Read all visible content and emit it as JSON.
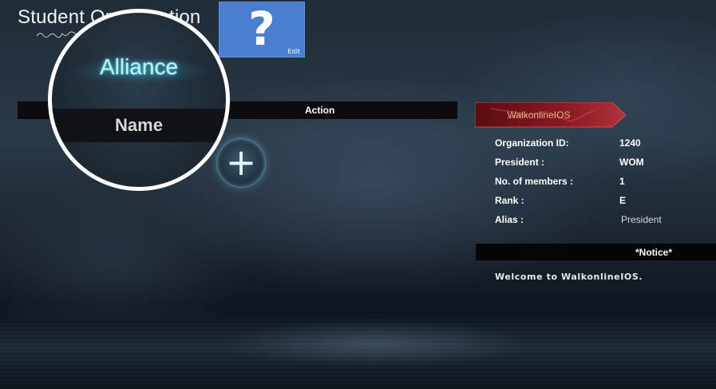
{
  "header": {
    "title": "Student Organization",
    "edit_tile": {
      "symbol": "?",
      "label": "Edit",
      "color": "#4a7fcf"
    }
  },
  "table": {
    "columns": [
      "Name",
      "Action"
    ],
    "add_button_icon": "plus-icon"
  },
  "magnifier": {
    "alliance_label": "Alliance",
    "name_label": "Name"
  },
  "organization": {
    "banner_name": "WalkonlineIOS",
    "banner_color": "#8a1a22",
    "fields": [
      {
        "label": "Organization ID:",
        "value": "1240"
      },
      {
        "label": "President :",
        "value": "WOM"
      },
      {
        "label": "No. of members :",
        "value": "1"
      },
      {
        "label": "Rank :",
        "value": "E"
      },
      {
        "label": "Alias :",
        "value": "President"
      }
    ]
  },
  "notice": {
    "title": "*Notice*",
    "body": "Welcome to WalkonlineIOS."
  }
}
